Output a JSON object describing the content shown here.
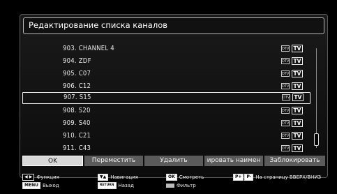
{
  "title": "Редактирование списка каналов",
  "channels": [
    {
      "name": "903. CHANNEL 4",
      "dtv": "DTV",
      "tv": "TV"
    },
    {
      "name": "904. ZDF",
      "dtv": "DTV",
      "tv": "TV"
    },
    {
      "name": "905. C07",
      "dtv": "DTV",
      "tv": "TV"
    },
    {
      "name": "906. C12",
      "dtv": "DTV",
      "tv": "TV"
    },
    {
      "name": "907. S15",
      "dtv": "DTV",
      "tv": "TV"
    },
    {
      "name": "908. S20",
      "dtv": "DTV",
      "tv": "TV"
    },
    {
      "name": "909. S40",
      "dtv": "DTV",
      "tv": "TV"
    },
    {
      "name": "910. C21",
      "dtv": "DTV",
      "tv": "TV"
    },
    {
      "name": "911. C43",
      "dtv": "DTV",
      "tv": "TV"
    }
  ],
  "selected_channel_index": 4,
  "buttons": {
    "ok": "OK",
    "move": "Переместить",
    "delete": "Удалить",
    "rename": "ировать наимен",
    "lock": "Заблокировать"
  },
  "legend": {
    "arrows_key": "◀ ▶",
    "function": "Функция",
    "menu_key": "MENU",
    "exit": "Выход",
    "updown_key": "▼▲",
    "navigation": "Навигация",
    "return_key": "RETURN",
    "back": "Назад",
    "ok_key": "OK",
    "watch": "Смотреть",
    "filter": "Фильтр",
    "page_key_plus": "P+",
    "page_key_minus": "P-",
    "page": "На страницу ВВЕРХ/ВНИЗ"
  }
}
